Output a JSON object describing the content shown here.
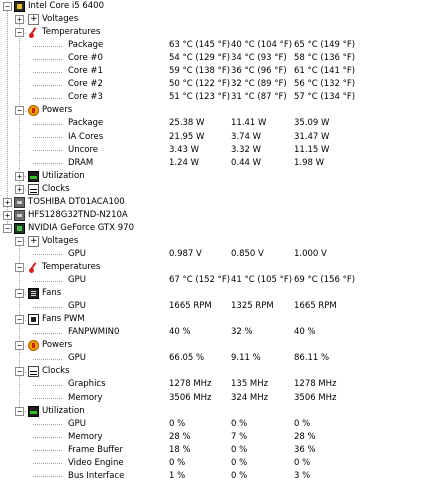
{
  "rows": [
    {
      "level": 0,
      "expander": "−",
      "icon": "cpu-chip-icon",
      "label": "Intel Core i5 6400"
    },
    {
      "level": 1,
      "expander": "+",
      "icon": "voltage-icon",
      "label": "Voltages"
    },
    {
      "level": 1,
      "expander": "−",
      "icon": "thermometer-icon",
      "label": "Temperatures"
    },
    {
      "level": 2,
      "label": "Package",
      "value": "63 °C  (145 °F)",
      "min": "40 °C  (104 °F)",
      "max": "65 °C  (149 °F)"
    },
    {
      "level": 2,
      "label": "Core #0",
      "value": "54 °C  (129 °F)",
      "min": "34 °C  (93 °F)",
      "max": "58 °C  (136 °F)"
    },
    {
      "level": 2,
      "label": "Core #1",
      "value": "59 °C  (138 °F)",
      "min": "36 °C  (96 °F)",
      "max": "61 °C  (141 °F)"
    },
    {
      "level": 2,
      "label": "Core #2",
      "value": "50 °C  (122 °F)",
      "min": "32 °C  (89 °F)",
      "max": "56 °C  (132 °F)"
    },
    {
      "level": 2,
      "label": "Core #3",
      "value": "51 °C  (123 °F)",
      "min": "31 °C  (87 °F)",
      "max": "57 °C  (134 °F)"
    },
    {
      "level": 1,
      "expander": "−",
      "icon": "power-icon",
      "label": "Powers"
    },
    {
      "level": 2,
      "label": "Package",
      "value": "25.38 W",
      "min": "11.41 W",
      "max": "35.09 W"
    },
    {
      "level": 2,
      "label": "IA Cores",
      "value": "21.95 W",
      "min": "3.74 W",
      "max": "31.47 W"
    },
    {
      "level": 2,
      "label": "Uncore",
      "value": "3.43 W",
      "min": "3.32 W",
      "max": "11.15 W"
    },
    {
      "level": 2,
      "label": "DRAM",
      "value": "1.24 W",
      "min": "0.44 W",
      "max": "1.98 W"
    },
    {
      "level": 1,
      "expander": "+",
      "icon": "utilization-icon",
      "label": "Utilization"
    },
    {
      "level": 1,
      "expander": "+",
      "icon": "clock-icon",
      "label": "Clocks"
    },
    {
      "level": 0,
      "expander": "+",
      "icon": "disk-icon",
      "label": "TOSHIBA DT01ACA100"
    },
    {
      "level": 0,
      "expander": "+",
      "icon": "disk-icon",
      "label": "HFS128G32TND-N210A"
    },
    {
      "level": 0,
      "expander": "−",
      "icon": "gpu-icon",
      "label": "NVIDIA GeForce GTX 970"
    },
    {
      "level": 1,
      "expander": "−",
      "icon": "voltage-icon",
      "label": "Voltages"
    },
    {
      "level": 2,
      "label": "GPU",
      "value": "0.987 V",
      "min": "0.850 V",
      "max": "1.000 V"
    },
    {
      "level": 1,
      "expander": "−",
      "icon": "thermometer-icon",
      "label": "Temperatures"
    },
    {
      "level": 2,
      "label": "GPU",
      "value": "67 °C  (152 °F)",
      "min": "41 °C  (105 °F)",
      "max": "69 °C  (156 °F)"
    },
    {
      "level": 1,
      "expander": "−",
      "icon": "fan-icon",
      "label": "Fans"
    },
    {
      "level": 2,
      "label": "GPU",
      "value": "1665 RPM",
      "min": "1325 RPM",
      "max": "1665 RPM"
    },
    {
      "level": 1,
      "expander": "−",
      "icon": "fan-pwm-icon",
      "label": "Fans PWM"
    },
    {
      "level": 2,
      "label": "FANPWMIN0",
      "value": "40 %",
      "min": "32 %",
      "max": "40 %"
    },
    {
      "level": 1,
      "expander": "−",
      "icon": "power-icon",
      "label": "Powers"
    },
    {
      "level": 2,
      "label": "GPU",
      "value": "66.05 %",
      "min": "9.11 %",
      "max": "86.11 %"
    },
    {
      "level": 1,
      "expander": "−",
      "icon": "clock-icon",
      "label": "Clocks"
    },
    {
      "level": 2,
      "label": "Graphics",
      "value": "1278 MHz",
      "min": "135 MHz",
      "max": "1278 MHz"
    },
    {
      "level": 2,
      "label": "Memory",
      "value": "3506 MHz",
      "min": "324 MHz",
      "max": "3506 MHz"
    },
    {
      "level": 1,
      "expander": "−",
      "icon": "utilization-icon",
      "label": "Utilization"
    },
    {
      "level": 2,
      "label": "GPU",
      "value": "0 %",
      "min": "0 %",
      "max": "0 %"
    },
    {
      "level": 2,
      "label": "Memory",
      "value": "28 %",
      "min": "7 %",
      "max": "28 %"
    },
    {
      "level": 2,
      "label": "Frame Buffer",
      "value": "18 %",
      "min": "0 %",
      "max": "36 %"
    },
    {
      "level": 2,
      "label": "Video Engine",
      "value": "0 %",
      "min": "0 %",
      "max": "0 %"
    },
    {
      "level": 2,
      "label": "Bus Interface",
      "value": "1 %",
      "min": "0 %",
      "max": "3 %"
    }
  ]
}
